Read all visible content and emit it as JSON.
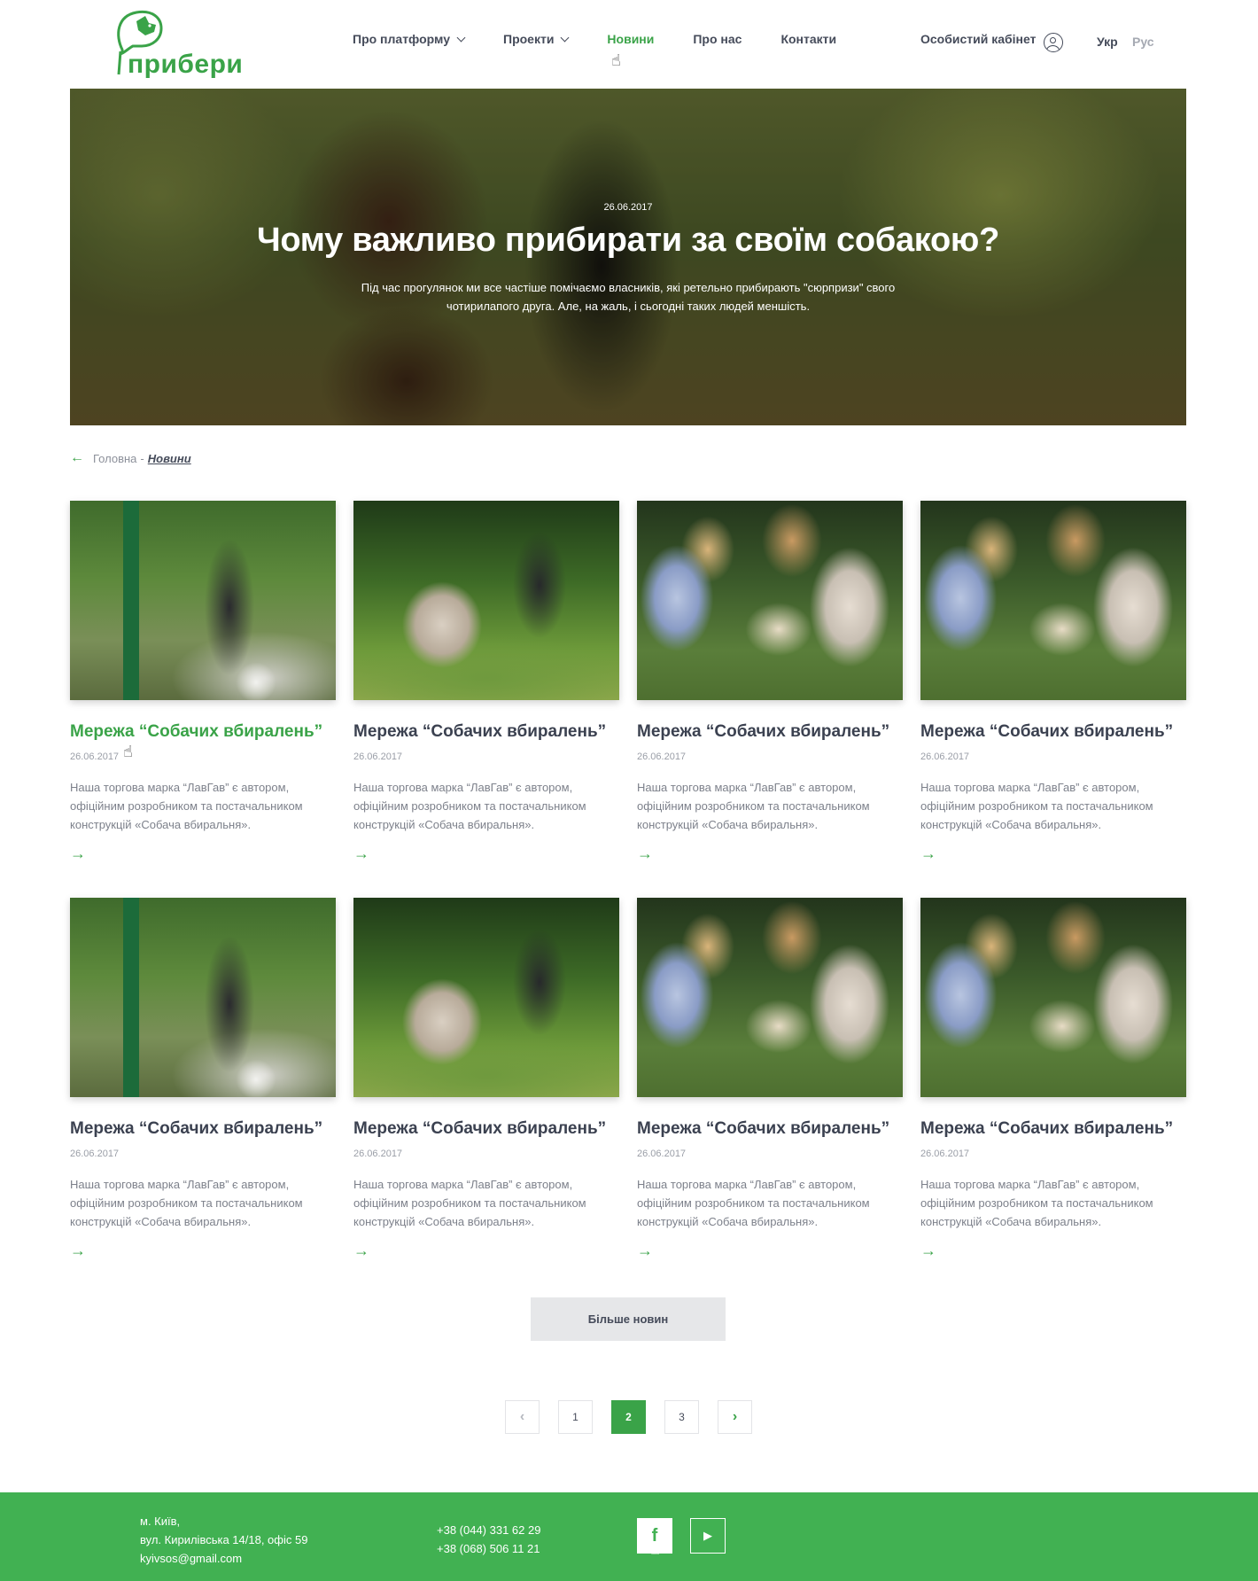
{
  "header": {
    "logo_text": "прибери",
    "nav": [
      {
        "label": "Про платформу",
        "has_dropdown": true,
        "active": false
      },
      {
        "label": "Проекти",
        "has_dropdown": true,
        "active": false
      },
      {
        "label": "Новини",
        "has_dropdown": false,
        "active": true
      },
      {
        "label": "Про нас",
        "has_dropdown": false,
        "active": false
      },
      {
        "label": "Контакти",
        "has_dropdown": false,
        "active": false
      }
    ],
    "account_label": "Особистий кабінет",
    "lang_uk": "Укр",
    "lang_ru": "Рус"
  },
  "hero": {
    "date": "26.06.2017",
    "title": "Чому важливо прибирати за своїм собакою?",
    "description": "Під час прогулянок ми все частіше помічаємо власників, які ретельно прибирають \"сюрпризи\" свого чотирилапого друга. Але, на жаль, і сьогодні таких людей меншість."
  },
  "breadcrumb": {
    "home": "Головна",
    "separator": "-",
    "current": "Новини"
  },
  "cards": [
    {
      "title": "Мережа “Собачих вбиралень”",
      "date": "26.06.2017",
      "text": "Наша торгова марка “ЛавГав” є автором, офіційним розробником та постачальником конструкцій «Собача вбиральня».",
      "image": "woman-with-dog-at-dispenser"
    },
    {
      "title": "Мережа “Собачих вбиралень”",
      "date": "26.06.2017",
      "text": "Наша торгова марка “ЛавГав” є автором, офіційним розробником та постачальником конструкцій «Собача вбиральня».",
      "image": "man-with-bulldog"
    },
    {
      "title": "Мережа “Собачих вбиралень”",
      "date": "26.06.2017",
      "text": "Наша торгова марка “ЛавГав” є автором, офіційним розробником та постачальником конструкцій «Собача вбиральня».",
      "image": "girls-with-dog"
    },
    {
      "title": "Мережа “Собачих вбиралень”",
      "date": "26.06.2017",
      "text": "Наша торгова марка “ЛавГав” є автором, офіційним розробником та постачальником конструкцій «Собача вбиральня».",
      "image": "girls-with-dog"
    },
    {
      "title": "Мережа “Собачих вбиралень”",
      "date": "26.06.2017",
      "text": "Наша торгова марка “ЛавГав” є автором, офіційним розробником та постачальником конструкцій «Собача вбиральня».",
      "image": "woman-with-dog-at-dispenser"
    },
    {
      "title": "Мережа “Собачих вбиралень”",
      "date": "26.06.2017",
      "text": "Наша торгова марка “ЛавГав” є автором, офіційним розробником та постачальником конструкцій «Собача вбиральня».",
      "image": "man-with-bulldog"
    },
    {
      "title": "Мережа “Собачих вбиралень”",
      "date": "26.06.2017",
      "text": "Наша торгова марка “ЛавГав” є автором, офіційним розробником та постачальником конструкцій «Собача вбиральня».",
      "image": "girls-with-dog"
    },
    {
      "title": "Мережа “Собачих вбиралень”",
      "date": "26.06.2017",
      "text": "Наша торгова марка “ЛавГав” є автором, офіційним розробником та постачальником конструкцій «Собача вбиральня».",
      "image": "girls-with-dog"
    }
  ],
  "more_button": "Більше новин",
  "pagination": {
    "pages": [
      "1",
      "2",
      "3"
    ],
    "current": "2"
  },
  "footer": {
    "city": "м. Київ,",
    "street": "вул. Кирилівська 14/18, офіс 59",
    "email": "kyivsos@gmail.com",
    "phone1": "+38 (044) 331 62 29",
    "phone2": "+38 (068) 506 11 21",
    "social": [
      "facebook-icon",
      "youtube-icon"
    ]
  },
  "colors": {
    "accent": "#3aa348",
    "footer_bg": "#41b152",
    "text_dark": "#3b4150",
    "button_bg": "#e6e7e9"
  }
}
